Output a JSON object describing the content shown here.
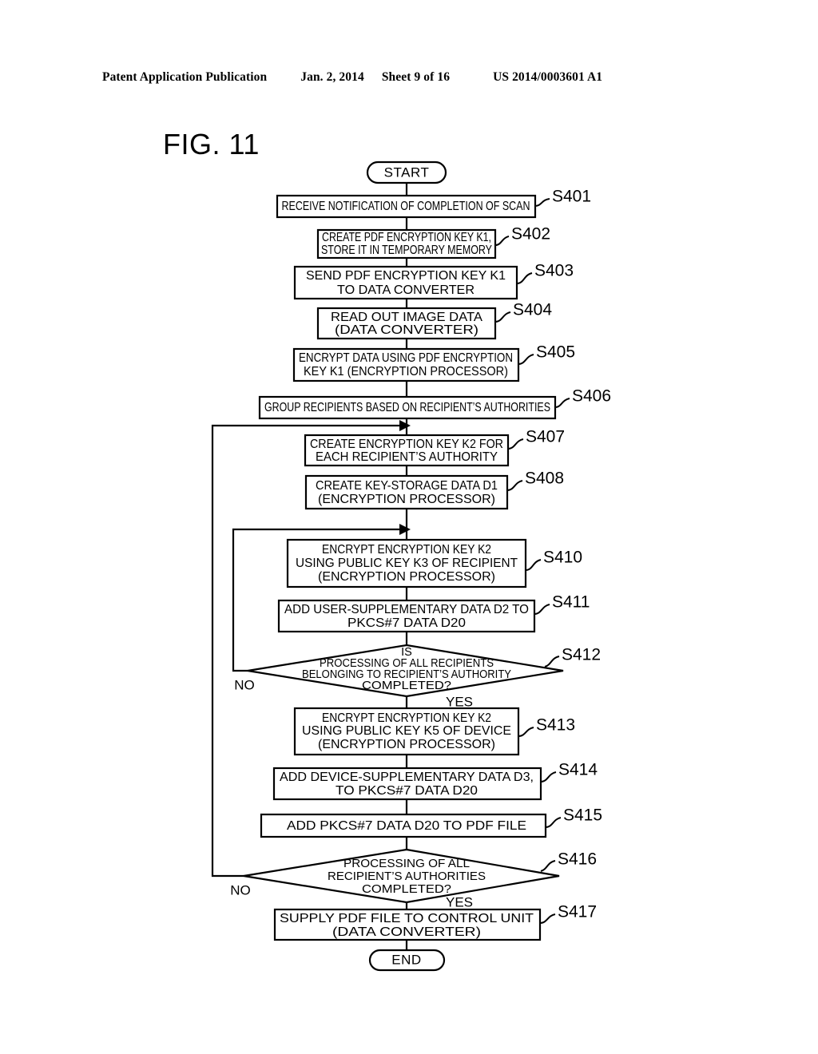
{
  "header": {
    "publication": "Patent Application Publication",
    "date": "Jan. 2, 2014",
    "sheet": "Sheet 9 of 16",
    "patent_number": "US 2014/0003601 A1"
  },
  "figure": {
    "label": "FIG. 11"
  },
  "flowchart": {
    "start_label": "START",
    "end_label": "END",
    "branch_no": "NO",
    "branch_yes": "YES",
    "steps": [
      {
        "id": "S401",
        "lines": [
          "RECEIVE NOTIFICATION OF COMPLETION OF SCAN"
        ]
      },
      {
        "id": "S402",
        "lines": [
          "CREATE PDF ENCRYPTION KEY K1,",
          "STORE IT IN TEMPORARY MEMORY"
        ]
      },
      {
        "id": "S403",
        "lines": [
          "SEND PDF ENCRYPTION KEY K1",
          "TO DATA CONVERTER"
        ]
      },
      {
        "id": "S404",
        "lines": [
          "READ OUT IMAGE DATA",
          "(DATA CONVERTER)"
        ]
      },
      {
        "id": "S405",
        "lines": [
          "ENCRYPT DATA USING PDF ENCRYPTION",
          "KEY K1 (ENCRYPTION PROCESSOR)"
        ]
      },
      {
        "id": "S406",
        "lines": [
          "GROUP RECIPIENTS BASED ON RECIPIENT’S AUTHORITIES"
        ]
      },
      {
        "id": "S407",
        "lines": [
          "CREATE ENCRYPTION KEY K2 FOR",
          "EACH RECIPIENT’S AUTHORITY"
        ]
      },
      {
        "id": "S408",
        "lines": [
          "CREATE KEY-STORAGE DATA D1",
          "(ENCRYPTION PROCESSOR)"
        ]
      },
      {
        "id": "S410",
        "lines": [
          "ENCRYPT ENCRYPTION KEY K2",
          "USING PUBLIC KEY K3 OF RECIPIENT",
          "(ENCRYPTION PROCESSOR)"
        ]
      },
      {
        "id": "S411",
        "lines": [
          "ADD USER-SUPPLEMENTARY DATA D2 TO",
          "PKCS#7 DATA D20"
        ]
      },
      {
        "id": "S412",
        "lines": [
          "IS",
          "PROCESSING OF ALL RECIPIENTS",
          "BELONGING TO RECIPIENT’S AUTHORITY",
          "COMPLETED?"
        ]
      },
      {
        "id": "S413",
        "lines": [
          "ENCRYPT ENCRYPTION KEY K2",
          "USING PUBLIC KEY K5 OF DEVICE",
          "(ENCRYPTION PROCESSOR)"
        ]
      },
      {
        "id": "S414",
        "lines": [
          "ADD DEVICE-SUPPLEMENTARY DATA D3,",
          "TO PKCS#7 DATA D20"
        ]
      },
      {
        "id": "S415",
        "lines": [
          "ADD PKCS#7 DATA D20 TO PDF FILE"
        ]
      },
      {
        "id": "S416",
        "lines": [
          "PROCESSING OF ALL",
          "RECIPIENT’S AUTHORITIES",
          "COMPLETED?"
        ]
      },
      {
        "id": "S417",
        "lines": [
          "SUPPLY PDF FILE TO CONTROL UNIT",
          "(DATA CONVERTER)"
        ]
      }
    ]
  }
}
